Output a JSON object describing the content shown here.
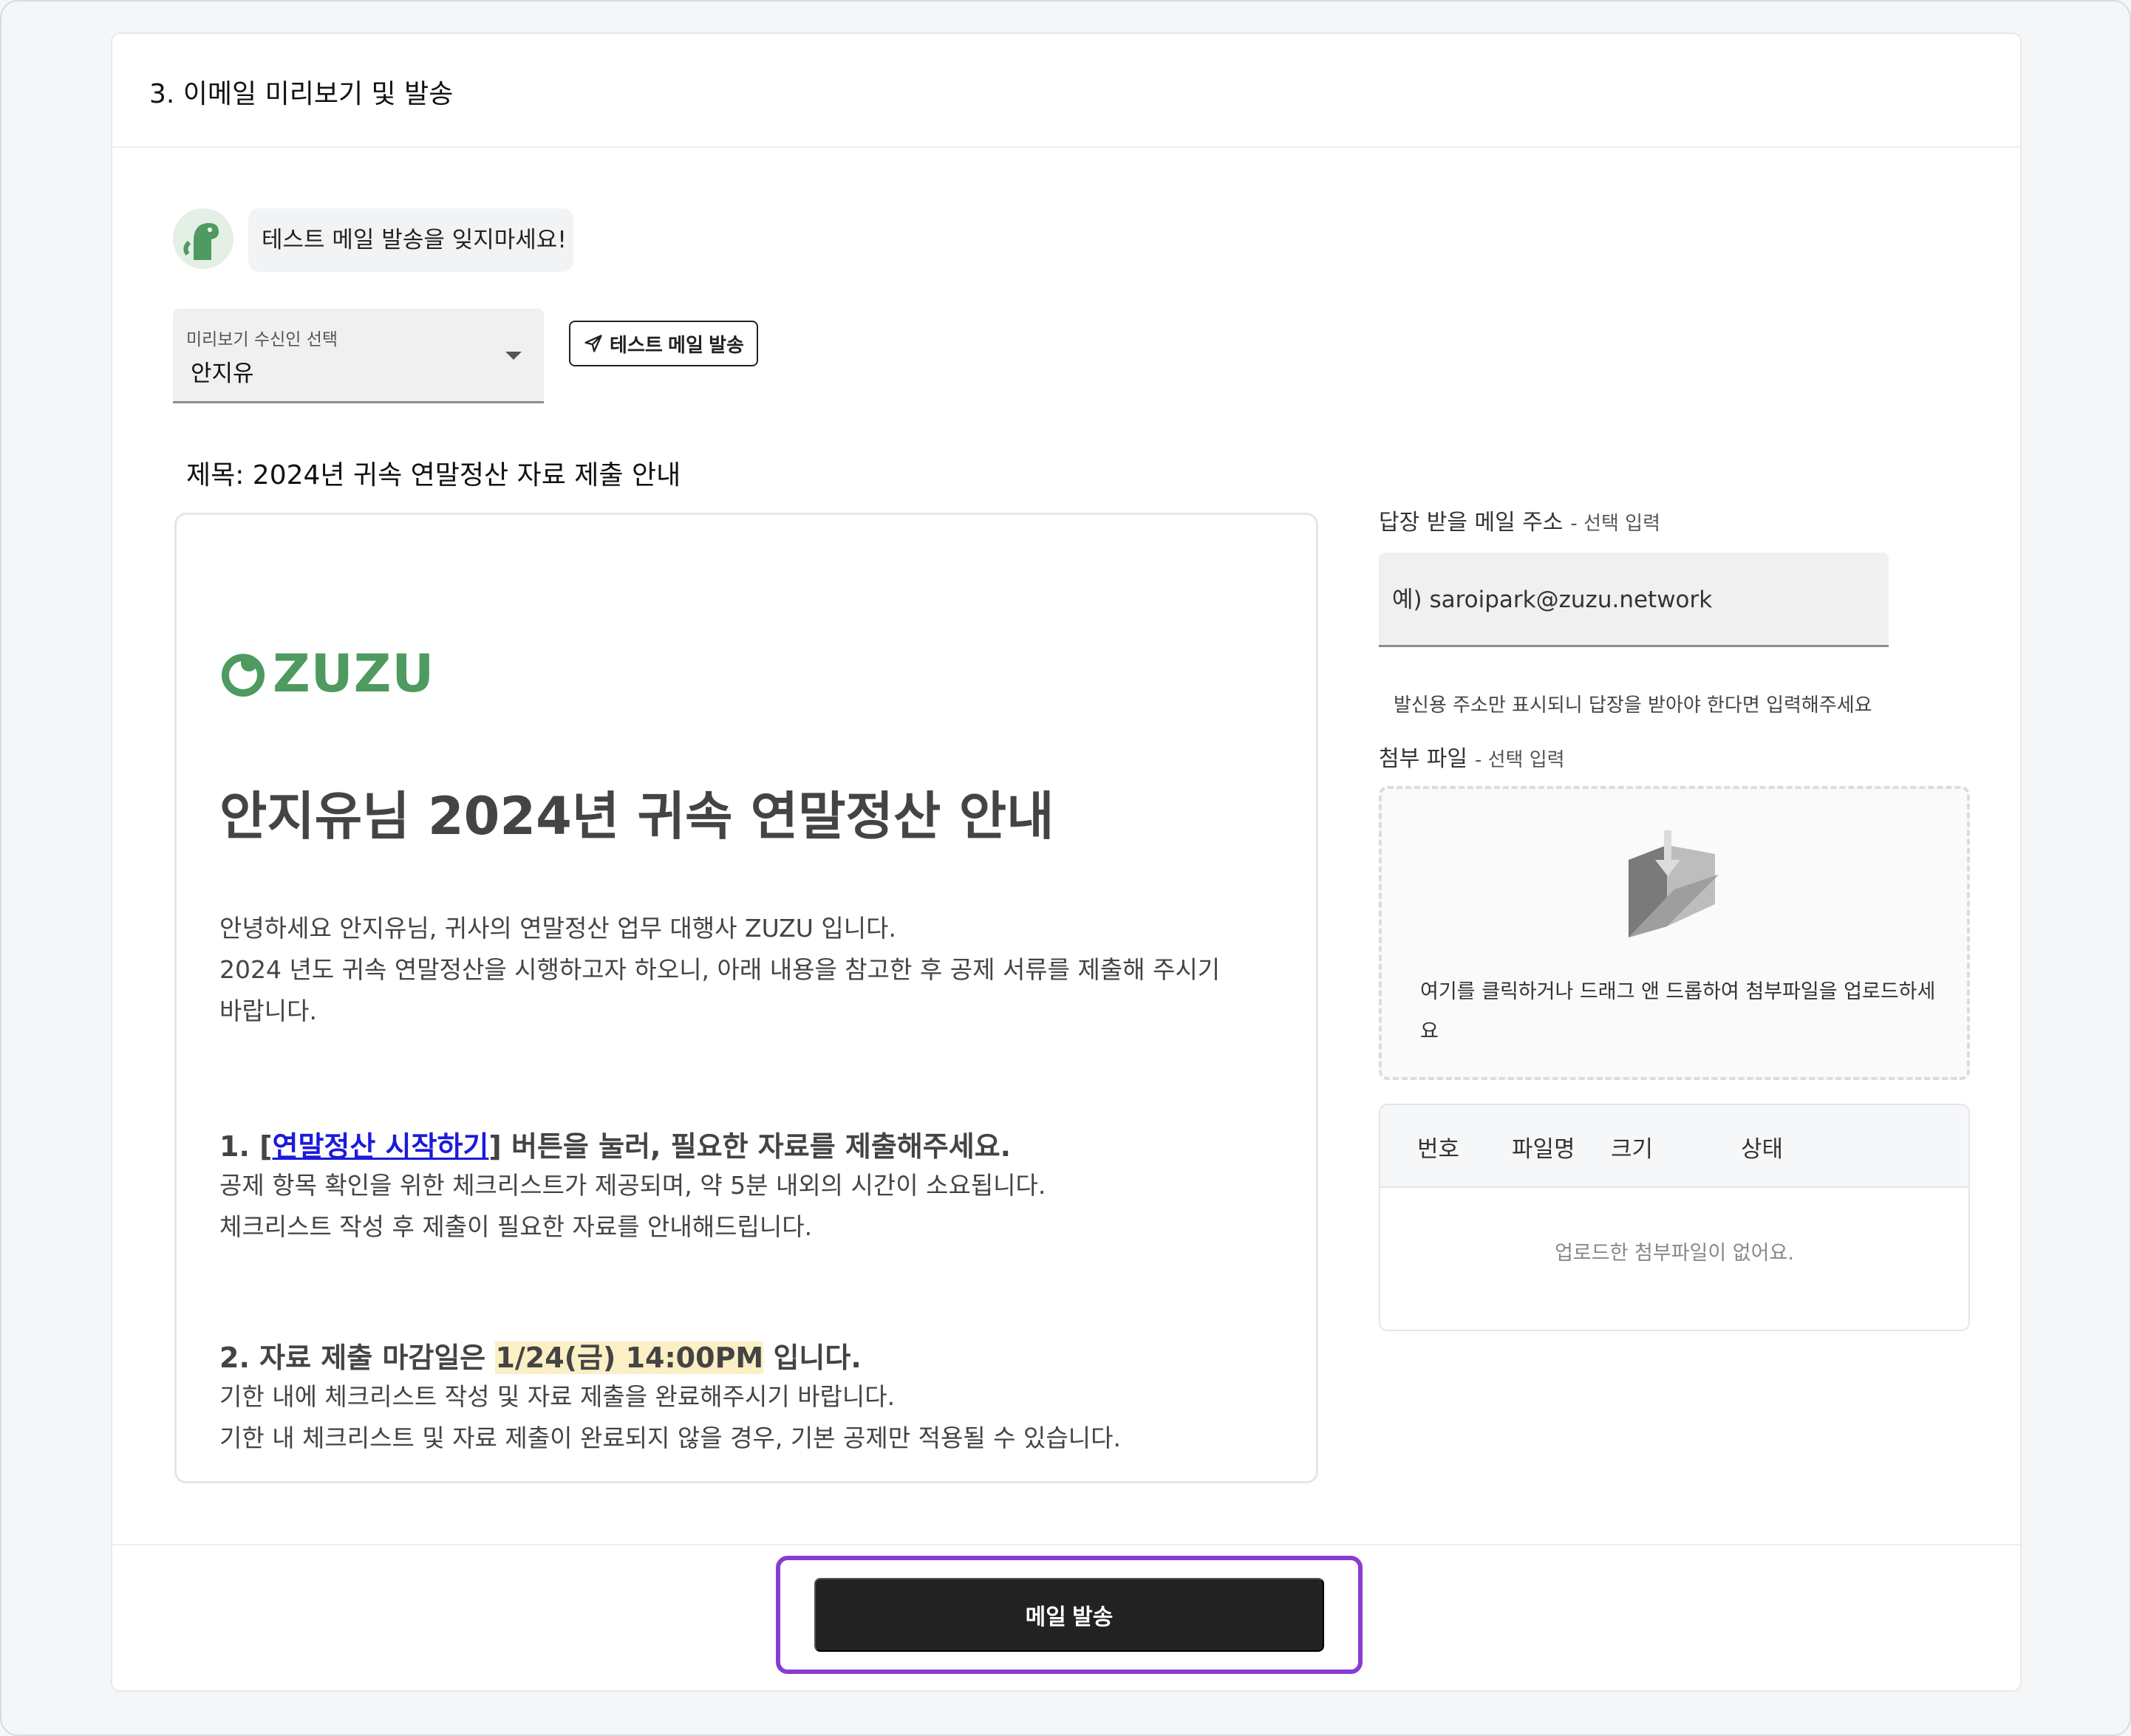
{
  "section": {
    "title": "3. 이메일 미리보기 및 발송"
  },
  "tip": {
    "message": "테스트 메일 발송을 잊지마세요!"
  },
  "recipient_select": {
    "label": "미리보기 수신인 선택",
    "value": "안지유"
  },
  "test_send": {
    "label": "테스트 메일 발송",
    "icon": "send-icon"
  },
  "subject": {
    "text": "제목: 2024년 귀속 연말정산 자료 제출 안내"
  },
  "email": {
    "logo_text": "ZUZU",
    "heading": "안지유님 2024년 귀속 연말정산 안내",
    "intro_line1": "안녕하세요 안지유님, 귀사의 연말정산 업무 대행사 ZUZU 입니다.",
    "intro_line2": "2024 년도 귀속 연말정산을 시행하고자 하오니, 아래 내용을 참고한 후 공제 서류를 제출해 주시기",
    "intro_line3": "바랍니다.",
    "s1_prefix": "1. [",
    "s1_link": "연말정산 시작하기",
    "s1_suffix": "] 버튼을 눌러, 필요한 자료를 제출해주세요.",
    "s1_line1": "공제 항목 확인을 위한 체크리스트가 제공되며, 약 5분 내외의 시간이 소요됩니다.",
    "s1_line2": "체크리스트 작성 후 제출이 필요한 자료를 안내해드립니다.",
    "s2_prefix": "2. 자료 제출 마감일은 ",
    "s2_highlight": "1/24(금) 14:00PM",
    "s2_suffix": " 입니다.",
    "s2_line1": "기한 내에 체크리스트 작성 및 자료 제출을 완료해주시기 바랍니다.",
    "s2_line2": "기한 내 체크리스트 및 자료 제출이 완료되지 않을 경우, 기본 공제만 적용될 수 있습니다.",
    "brand_color": "#4e9a60"
  },
  "reply": {
    "label": "답장 받을 메일 주소",
    "optional": "- 선택 입력",
    "placeholder": "예) saroipark@zuzu.network",
    "helper": "발신용 주소만 표시되니 답장을 받아야 한다면 입력해주세요"
  },
  "attachment": {
    "label": "첨부 파일",
    "optional": "- 선택 입력",
    "dropzone_text": "여기를 클릭하거나 드래그 앤 드롭하여 첨부파일을 업로드하세요",
    "columns": [
      "번호",
      "파일명",
      "크기",
      "상태"
    ],
    "empty_text": "업로드한 첨부파일이 없어요."
  },
  "send": {
    "label": "메일 발송",
    "highlight_color": "#8a3bd1"
  }
}
